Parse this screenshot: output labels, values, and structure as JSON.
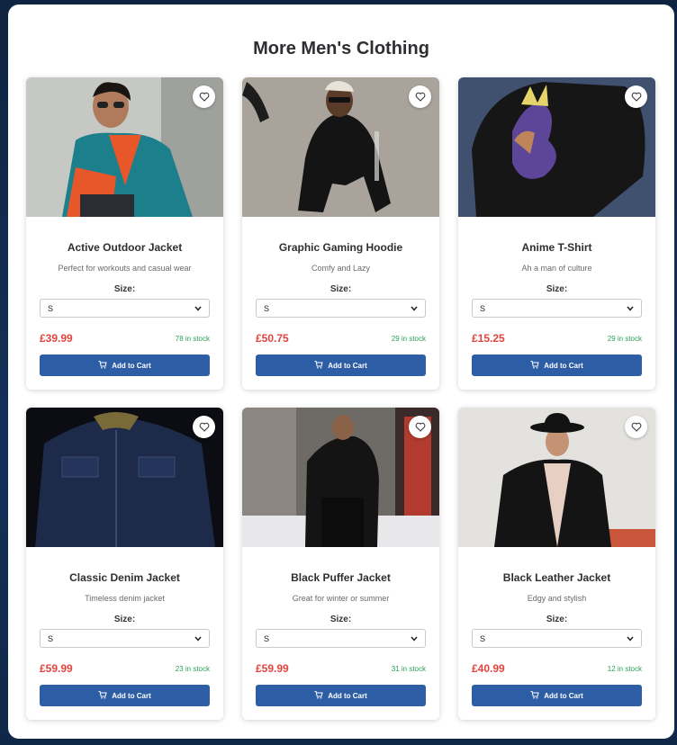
{
  "section": {
    "title": "More Men's Clothing"
  },
  "colors": {
    "accent": "#2d5ea5",
    "price": "#e0443f",
    "stock": "#2aa05a"
  },
  "products": [
    {
      "name": "Active Outdoor Jacket",
      "description": "Perfect for workouts and casual wear",
      "size_label": "Size:",
      "size": "S",
      "price": "£39.99",
      "stock": "78 in stock",
      "cart_label": "Add to Cart",
      "image": "man-in-teal-orange-windbreaker"
    },
    {
      "name": "Graphic Gaming Hoodie",
      "description": "Comfy and Lazy",
      "size_label": "Size:",
      "size": "S",
      "price": "£50.75",
      "stock": "29 in stock",
      "cart_label": "Add to Cart",
      "image": "man-crouching-in-black-hoodie"
    },
    {
      "name": "Anime T-Shirt",
      "description": "Ah a man of culture",
      "size_label": "Size:",
      "size": "S",
      "price": "£15.25",
      "stock": "29 in stock",
      "cart_label": "Add to Cart",
      "image": "black-tshirt-anime-print"
    },
    {
      "name": "Classic Denim Jacket",
      "description": "Timeless denim jacket",
      "size_label": "Size:",
      "size": "S",
      "price": "£59.99",
      "stock": "23 in stock",
      "cart_label": "Add to Cart",
      "image": "dark-denim-jacket"
    },
    {
      "name": "Black Puffer Jacket",
      "description": "Great for winter or summer",
      "size_label": "Size:",
      "size": "S",
      "price": "£59.99",
      "stock": "31 in stock",
      "cart_label": "Add to Cart",
      "image": "man-in-black-puffer-street"
    },
    {
      "name": "Black Leather Jacket",
      "description": "Edgy and stylish",
      "size_label": "Size:",
      "size": "S",
      "price": "£40.99",
      "stock": "12 in stock",
      "cart_label": "Add to Cart",
      "image": "man-in-leather-jacket-and-hat"
    }
  ]
}
